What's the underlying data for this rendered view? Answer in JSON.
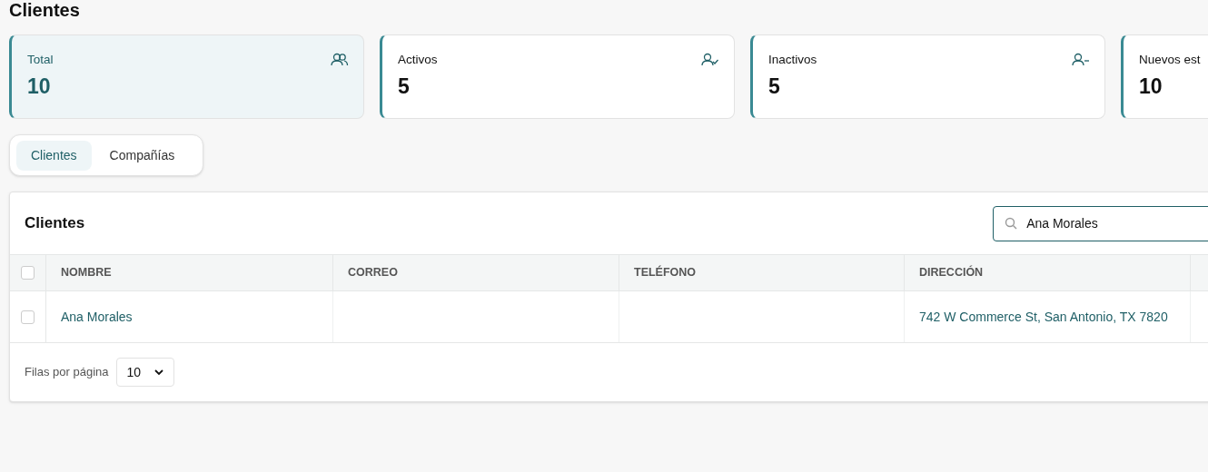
{
  "page_title": "Clientes",
  "stats": [
    {
      "label": "Total",
      "value": "10",
      "kind": "group",
      "selected": true
    },
    {
      "label": "Activos",
      "value": "5",
      "kind": "check",
      "selected": false
    },
    {
      "label": "Inactivos",
      "value": "5",
      "kind": "minus",
      "selected": false
    },
    {
      "label": "Nuevos est",
      "value": "10",
      "kind": "plain",
      "selected": false
    }
  ],
  "tabs": [
    {
      "label": "Clientes",
      "selected": true
    },
    {
      "label": "Compañías",
      "selected": false
    }
  ],
  "table": {
    "title": "Clientes",
    "search": {
      "value": "Ana Morales"
    },
    "select_all": {
      "checked": false
    },
    "columns": [
      "NOMBRE",
      "CORREO",
      "TELÉFONO",
      "DIRECCIÓN"
    ],
    "rows": [
      {
        "checked": false,
        "cells": [
          "Ana Morales",
          "",
          "",
          "742 W Commerce St, San Antonio, TX 7820"
        ]
      }
    ],
    "rows_per_page": {
      "label": "Filas por página",
      "value": "10"
    }
  }
}
